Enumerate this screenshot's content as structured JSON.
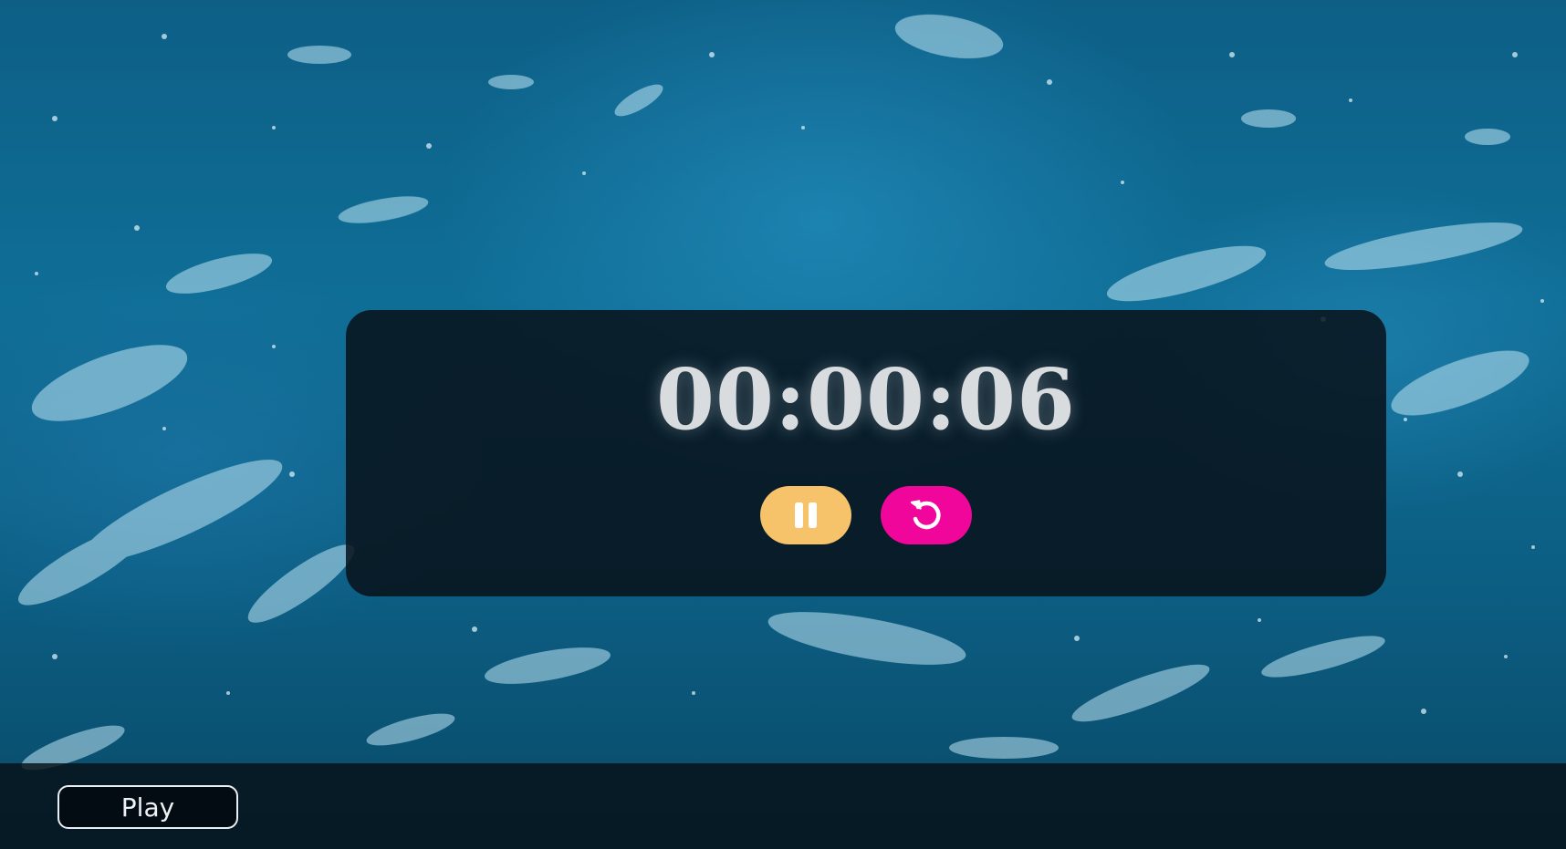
{
  "timer": {
    "display": "00:00:06"
  },
  "controls": {
    "pause_icon": "pause-icon",
    "reset_icon": "reset-icon"
  },
  "footer": {
    "play_label": "Play"
  },
  "colors": {
    "pause_button": "#f6c26a",
    "reset_button": "#f0069a",
    "panel_background": "#08121a",
    "timer_text": "#d9dcdf"
  }
}
